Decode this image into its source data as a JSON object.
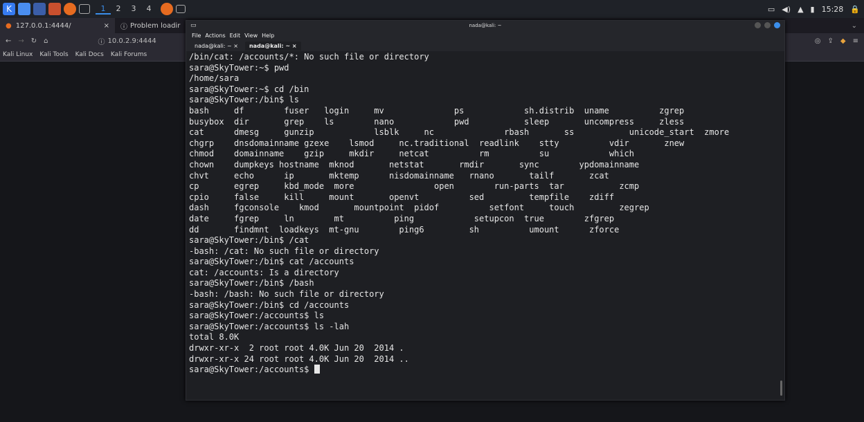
{
  "taskbar": {
    "workspaces": [
      "1",
      "2",
      "3",
      "4"
    ],
    "active_workspace": "1",
    "clock": "15:28"
  },
  "browser": {
    "tab1": "127.0.0.1:4444/",
    "tab2": "Problem loadir",
    "url": "10.0.2.9:4444",
    "bookmarks": [
      "Kali Linux",
      "Kali Tools",
      "Kali Docs",
      "Kali Forums"
    ]
  },
  "terminal": {
    "title": "nada@kali: ~",
    "menu": [
      "File",
      "Actions",
      "Edit",
      "View",
      "Help"
    ],
    "tabs": [
      "nada@kali: ~",
      "nada@kali: ~"
    ],
    "lines": [
      "/bin/cat: /accounts/*: No such file or directory",
      "sara@SkyTower:~$ pwd",
      "/home/sara",
      "sara@SkyTower:~$ cd /bin",
      "sara@SkyTower:/bin$ ls",
      "bash     df        fuser   login     mv              ps            sh.distrib  uname          zgrep",
      "busybox  dir       grep    ls        nano            pwd           sleep       uncompress     zless",
      "cat      dmesg     gunzip            lsblk     nc              rbash       ss           unicode_start  zmore",
      "chgrp    dnsdomainname gzexe    lsmod     nc.traditional  readlink    stty          vdir       znew",
      "chmod    domainname    gzip     mkdir     netcat          rm          su            which",
      "chown    dumpkeys hostname  mknod       netstat       rmdir       sync        ypdomainname",
      "chvt     echo      ip       mktemp      nisdomainname   rnano       tailf       zcat",
      "cp       egrep     kbd_mode  more                open        run-parts  tar           zcmp",
      "cpio     false     kill     mount       openvt          sed         tempfile    zdiff",
      "dash     fgconsole    kmod       mountpoint  pidof          setfont     touch         zegrep",
      "date     fgrep     ln        mt          ping            setupcon  true        zfgrep",
      "dd       findmnt  loadkeys  mt-gnu        ping6         sh          umount      zforce",
      "sara@SkyTower:/bin$ /cat",
      "-bash: /cat: No such file or directory",
      "sara@SkyTower:/bin$ cat /accounts",
      "cat: /accounts: Is a directory",
      "sara@SkyTower:/bin$ /bash",
      "-bash: /bash: No such file or directory",
      "sara@SkyTower:/bin$ cd /accounts",
      "sara@SkyTower:/accounts$ ls",
      "sara@SkyTower:/accounts$ ls -lah",
      "total 8.0K",
      "drwxr-xr-x  2 root root 4.0K Jun 20  2014 .",
      "drwxr-xr-x 24 root root 4.0K Jun 20  2014 ..",
      "sara@SkyTower:/accounts$ "
    ]
  }
}
